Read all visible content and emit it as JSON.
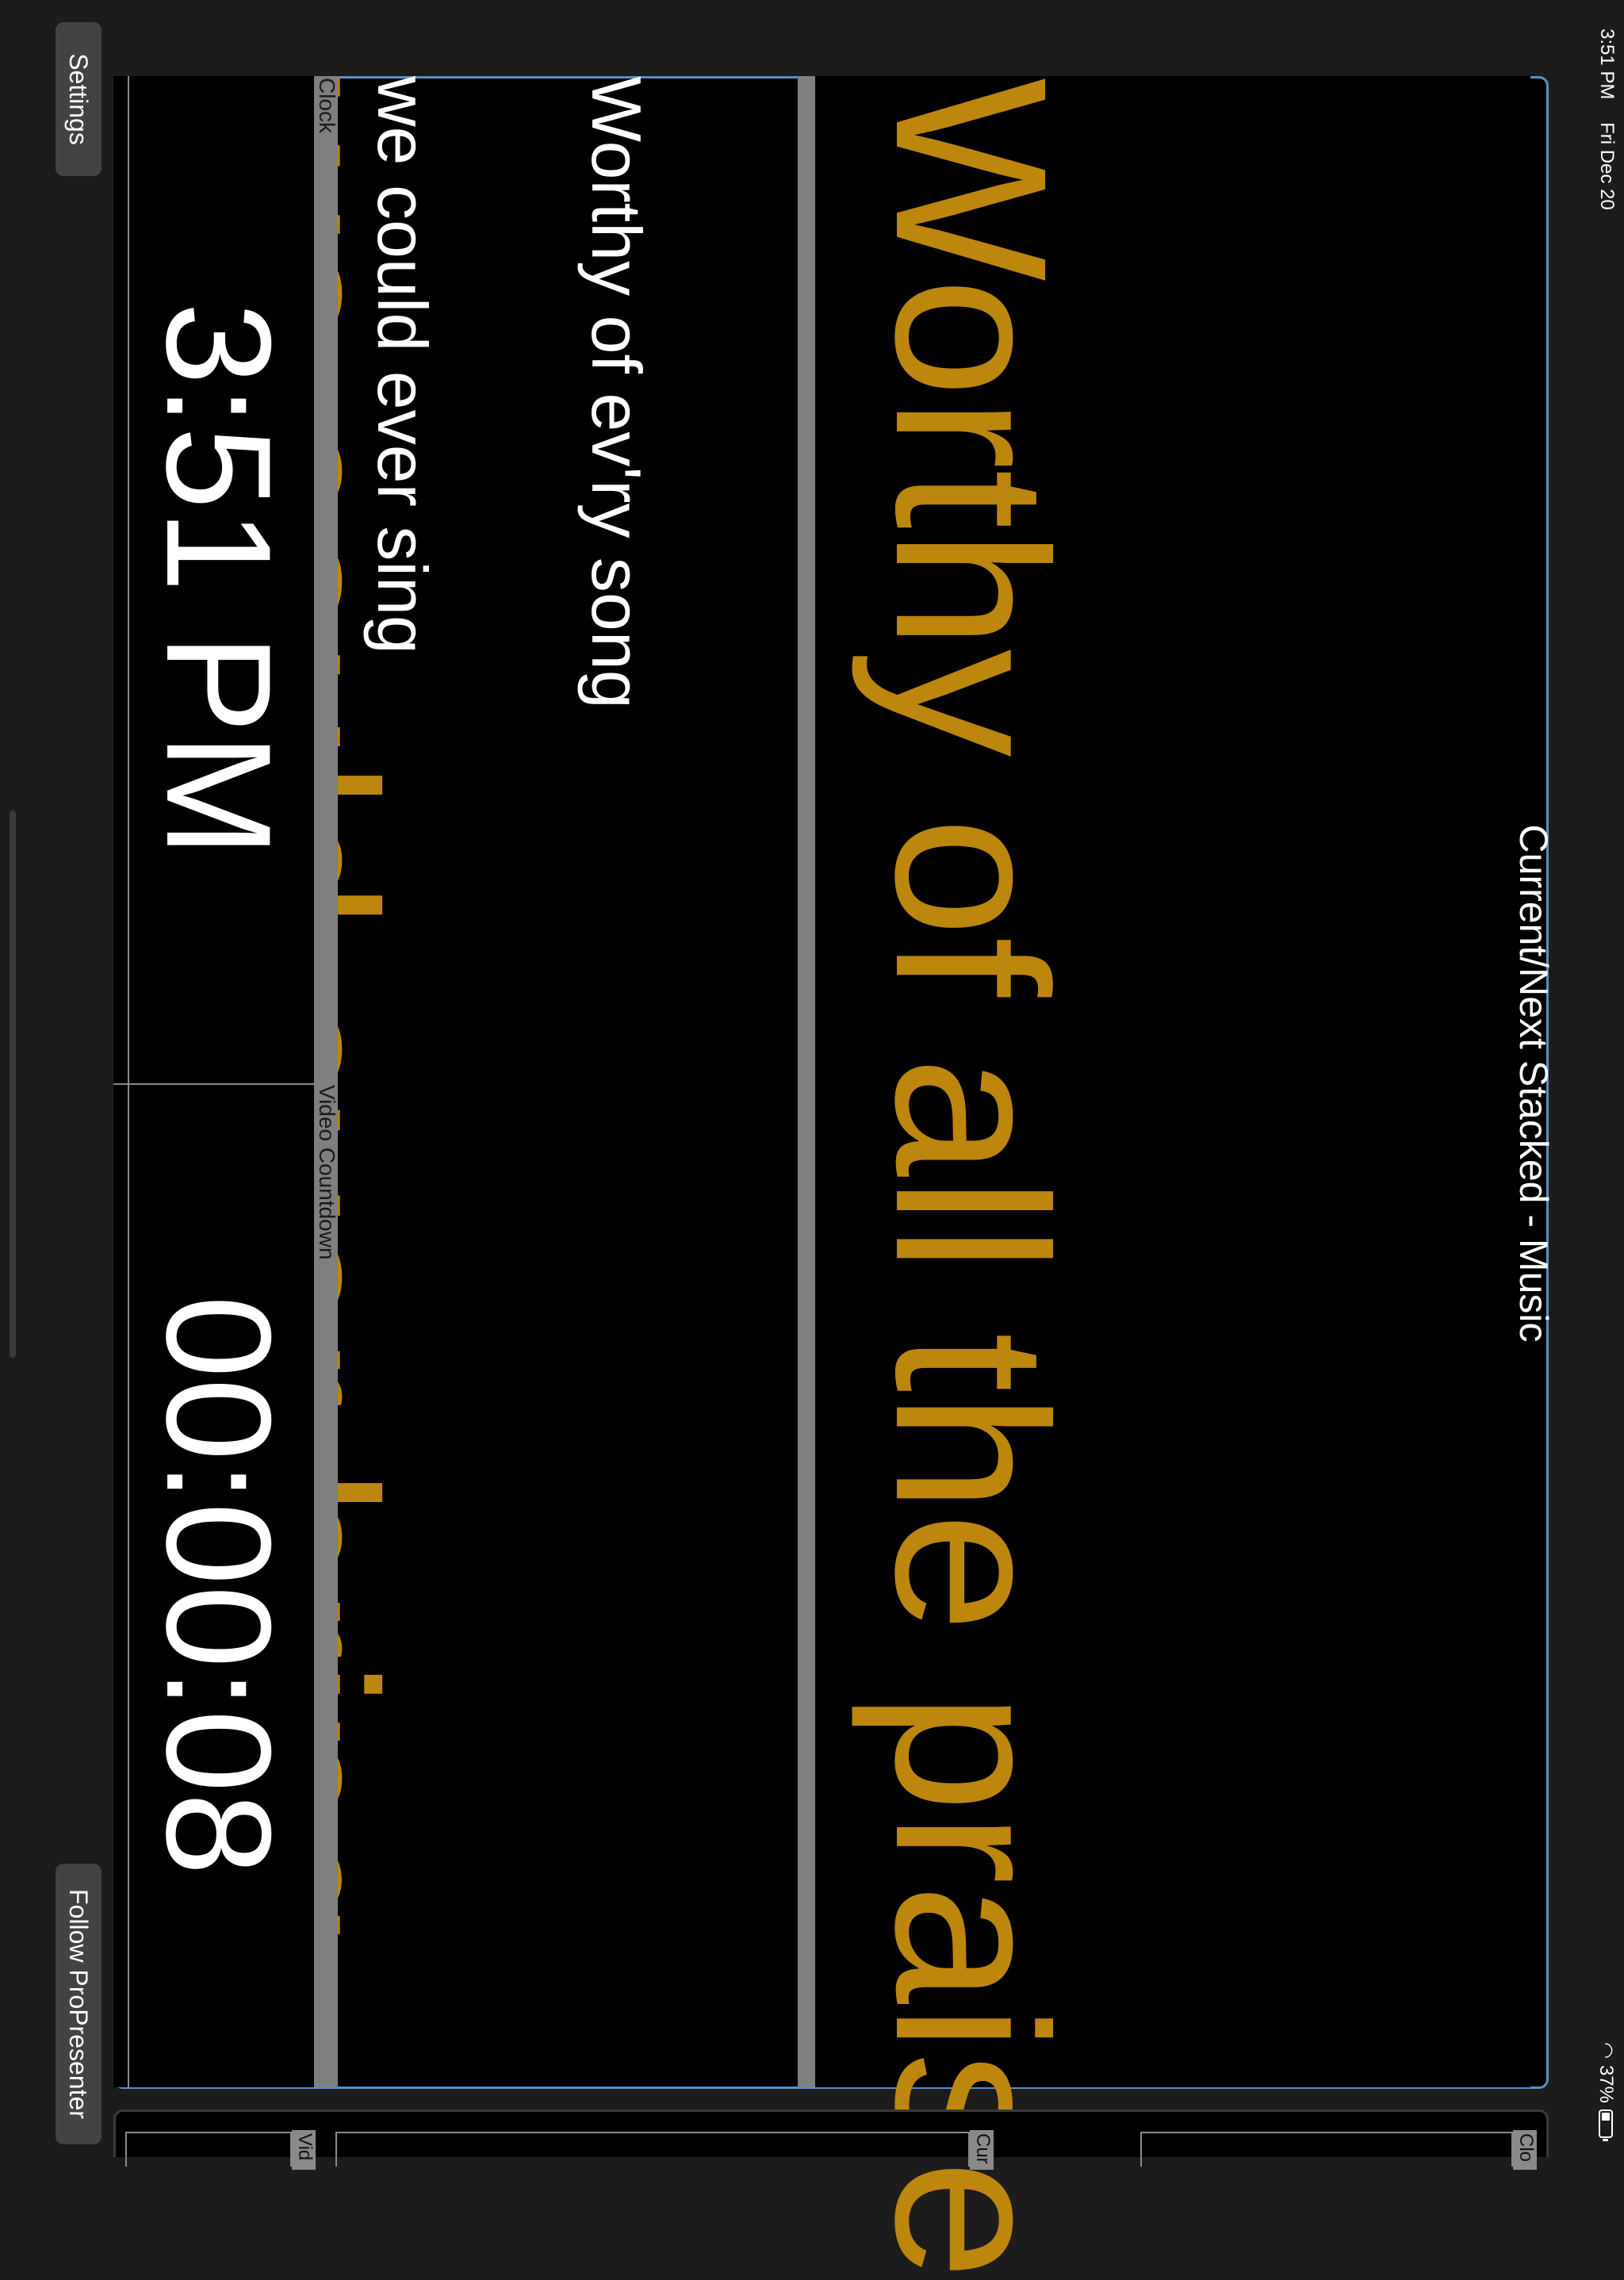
{
  "status_bar": {
    "time": "3:51 PM",
    "date": "Fri Dec 20",
    "battery": "37%",
    "battery_level": 0.37
  },
  "layout": {
    "title": "Current/Next Stacked - Music"
  },
  "current_slide": {
    "line1": "Worthy of all the praise",
    "line2": "we could ever bring"
  },
  "next_slide": {
    "line1": "Worthy of ev'ry song",
    "line2": "we could ever sing"
  },
  "clock": {
    "label": "Clock",
    "value": "3:51 PM"
  },
  "video_countdown": {
    "label": "Video Countdown",
    "value": "00:00:08"
  },
  "buttons": {
    "settings": "Settings",
    "follow": "Follow ProPresenter"
  },
  "side_panel": {
    "labels": [
      "Clo",
      "Cur",
      "Vid"
    ]
  },
  "colors": {
    "current_text": "#bd860c",
    "frame_border": "#5b8fc4",
    "background": "#1c1c1c"
  }
}
